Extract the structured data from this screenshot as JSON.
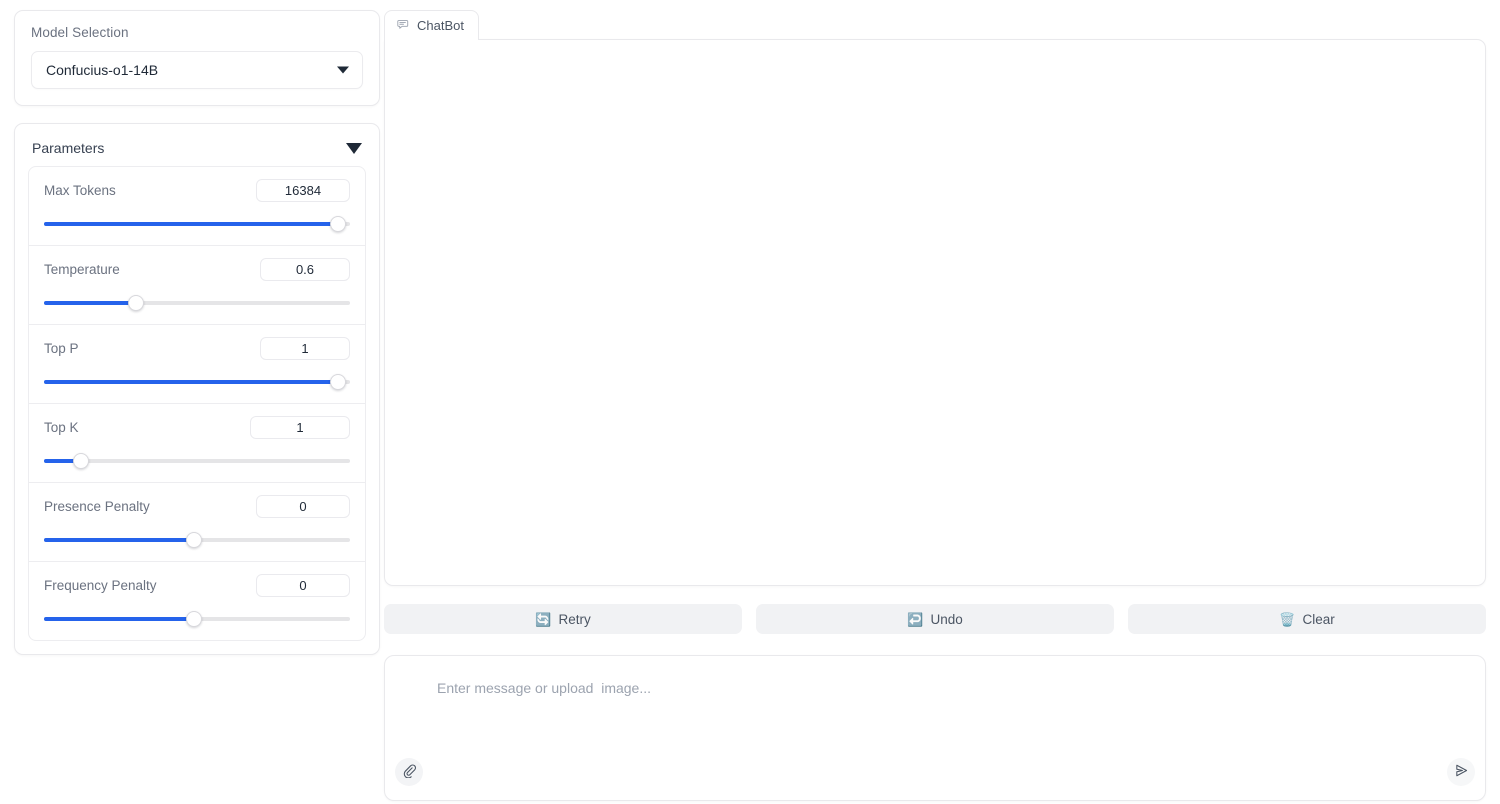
{
  "sidebar": {
    "model_selection": {
      "label": "Model Selection",
      "selected": "Confucius-o1-14B",
      "caret_icon": "chevron-down-icon"
    },
    "parameters": {
      "title": "Parameters",
      "collapse_icon": "triangle-down-icon",
      "items": [
        {
          "label": "Max Tokens",
          "value": "16384",
          "fill_pct": 96,
          "thumb_pct": 96
        },
        {
          "label": "Temperature",
          "value": "0.6",
          "fill_pct": 30,
          "thumb_pct": 30
        },
        {
          "label": "Top P",
          "value": "1",
          "fill_pct": 96,
          "thumb_pct": 96
        },
        {
          "label": "Top K",
          "value": "1",
          "fill_pct": 12,
          "thumb_pct": 12
        },
        {
          "label": "Presence Penalty",
          "value": "0",
          "fill_pct": 49,
          "thumb_pct": 49
        },
        {
          "label": "Frequency Penalty",
          "value": "0",
          "fill_pct": 49,
          "thumb_pct": 49
        }
      ]
    }
  },
  "main": {
    "tab": {
      "label": "ChatBot",
      "icon": "chat-bubble-icon"
    },
    "actions": [
      {
        "label": "Retry",
        "icon": "counterclockwise-arrows-icon",
        "glyph": "🔄"
      },
      {
        "label": "Undo",
        "icon": "undo-arrow-icon",
        "glyph": "↩️"
      },
      {
        "label": "Clear",
        "icon": "wastebasket-icon",
        "glyph": "🗑️"
      }
    ],
    "composer": {
      "placeholder": "Enter message or upload  image...",
      "attach_icon": "paperclip-icon",
      "send_icon": "send-paper-plane-icon"
    }
  },
  "colors": {
    "accent": "#2563eb",
    "track": "#e5e5e7",
    "border": "#e9e9ec",
    "button_bg": "#f1f2f4",
    "label_text": "#6b7280",
    "value_text": "#1f2937",
    "placeholder_text": "#9ca3af"
  }
}
